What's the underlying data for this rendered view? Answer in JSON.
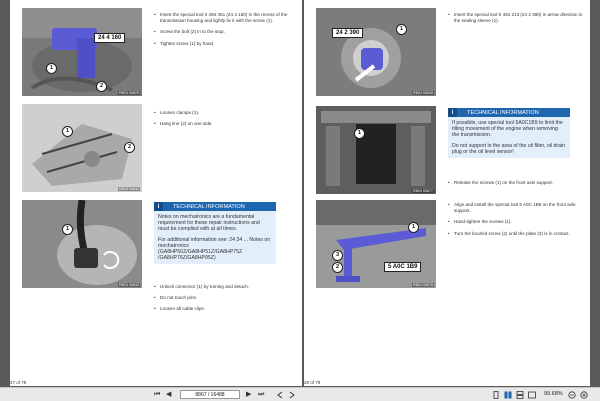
{
  "left_page": {
    "page_number": "27 of 79",
    "section1": {
      "tool_label": "24 4 160",
      "callouts": [
        "1",
        "2"
      ],
      "ref": "RB24 00625",
      "steps": [
        "Insert the special tool 0 494 451 (24 4 160) in the recess of the transmission housing and lightly fix it with the screw (1).",
        "Screw the bolt (2) in to the stop.",
        "Tighten screw (1) by hand."
      ]
    },
    "section2": {
      "callouts": [
        "1",
        "2"
      ],
      "ref": "RB24 00632",
      "steps": [
        "Loosen clamps (1).",
        "Hang line (2) on one side."
      ]
    },
    "section3": {
      "callouts": [
        "1"
      ],
      "ref": "RB24 00633",
      "info_icon": "i",
      "tech_title": "TECHNICAL INFORMATION",
      "tech_paragraphs": [
        "Notes on mechatronics are a fundamental requirement for these repair instructions and must be complied with at all times.",
        "For additional information see: 24 34 ... Notes on mechatronics (GA8HP50Z/GA8HP51Z/GA8HP75Z /GA8HP76Z/GA8HP95Z)"
      ],
      "steps": [
        "Unlock connector (1) by turning and detach.",
        "Do not touch pins.",
        "Loosen all cable clips."
      ]
    }
  },
  "right_page": {
    "page_number": "28 of 79",
    "section1": {
      "tool_label": "24 2 390",
      "callouts": [
        "1"
      ],
      "ref": "RB24 00638",
      "steps": [
        "Insert the special tool 0 494 213 (24 2 390) in arrow direction in the sealing sleeve (1)."
      ]
    },
    "section2": {
      "callouts": [
        "1"
      ],
      "ref": "RB24 00677",
      "info_icon": "i",
      "tech_title": "TECHNICAL INFORMATION",
      "tech_paragraphs": [
        "If possible, use special tool 5A0C1B9 to limit the tilting movement of the engine when removing the transmission.",
        "Do not support in the area of the oil filter, oil drain plug or the oil level sensor!"
      ],
      "steps": [
        "Release the screws (1) on the front axle support."
      ]
    },
    "section3": {
      "tool_label": "5 A0C 1B9",
      "callouts": [
        "1",
        "2",
        "3"
      ],
      "ref": "RB24 00678",
      "steps": [
        "Align and install the special tool 5 A0C 1B9 on the front axle support.",
        "Hand-tighten the screws (1).",
        "Turn the knurled screw (2) until the plate (3) is in contact."
      ]
    }
  },
  "toolbar": {
    "first_icon": "first-page-icon",
    "prev_icon": "prev-page-icon",
    "next_icon": "next-page-icon",
    "last_icon": "last-page-icon",
    "page_indicator": "8867 / 16488",
    "zoom": "99.68%"
  },
  "colors": {
    "accent": "#1e66b0",
    "info_bg": "#e2eefa",
    "tool_purple": "#5b5bd6"
  }
}
